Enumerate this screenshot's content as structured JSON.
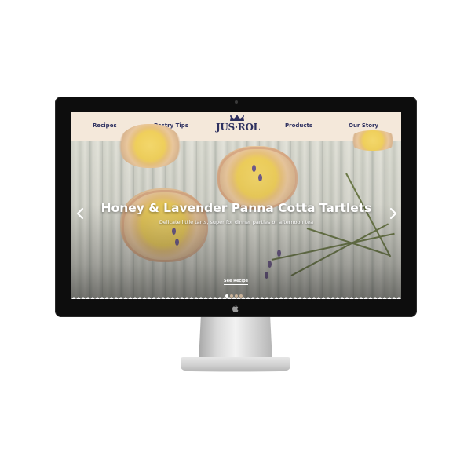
{
  "nav": {
    "links": [
      "Recipes",
      "Pastry Tips",
      "Products",
      "Our Story"
    ],
    "logo_text": "JUS·ROL"
  },
  "hero": {
    "title": "Honey & Lavender Panna Cotta Tartlets",
    "subtitle": "Delicate little tarts, super for dinner parties or afternoon tea",
    "cta": "See Recipe",
    "slides": 4,
    "active_slide": 1
  },
  "icons": {
    "prev": "chevron-left-icon",
    "next": "chevron-right-icon",
    "device": "apple-logo-icon",
    "brand": "crown-icon"
  },
  "colors": {
    "nav_background": "#f4e8da",
    "brand_navy": "#2e3160",
    "bezel": "#0d0d0d"
  }
}
